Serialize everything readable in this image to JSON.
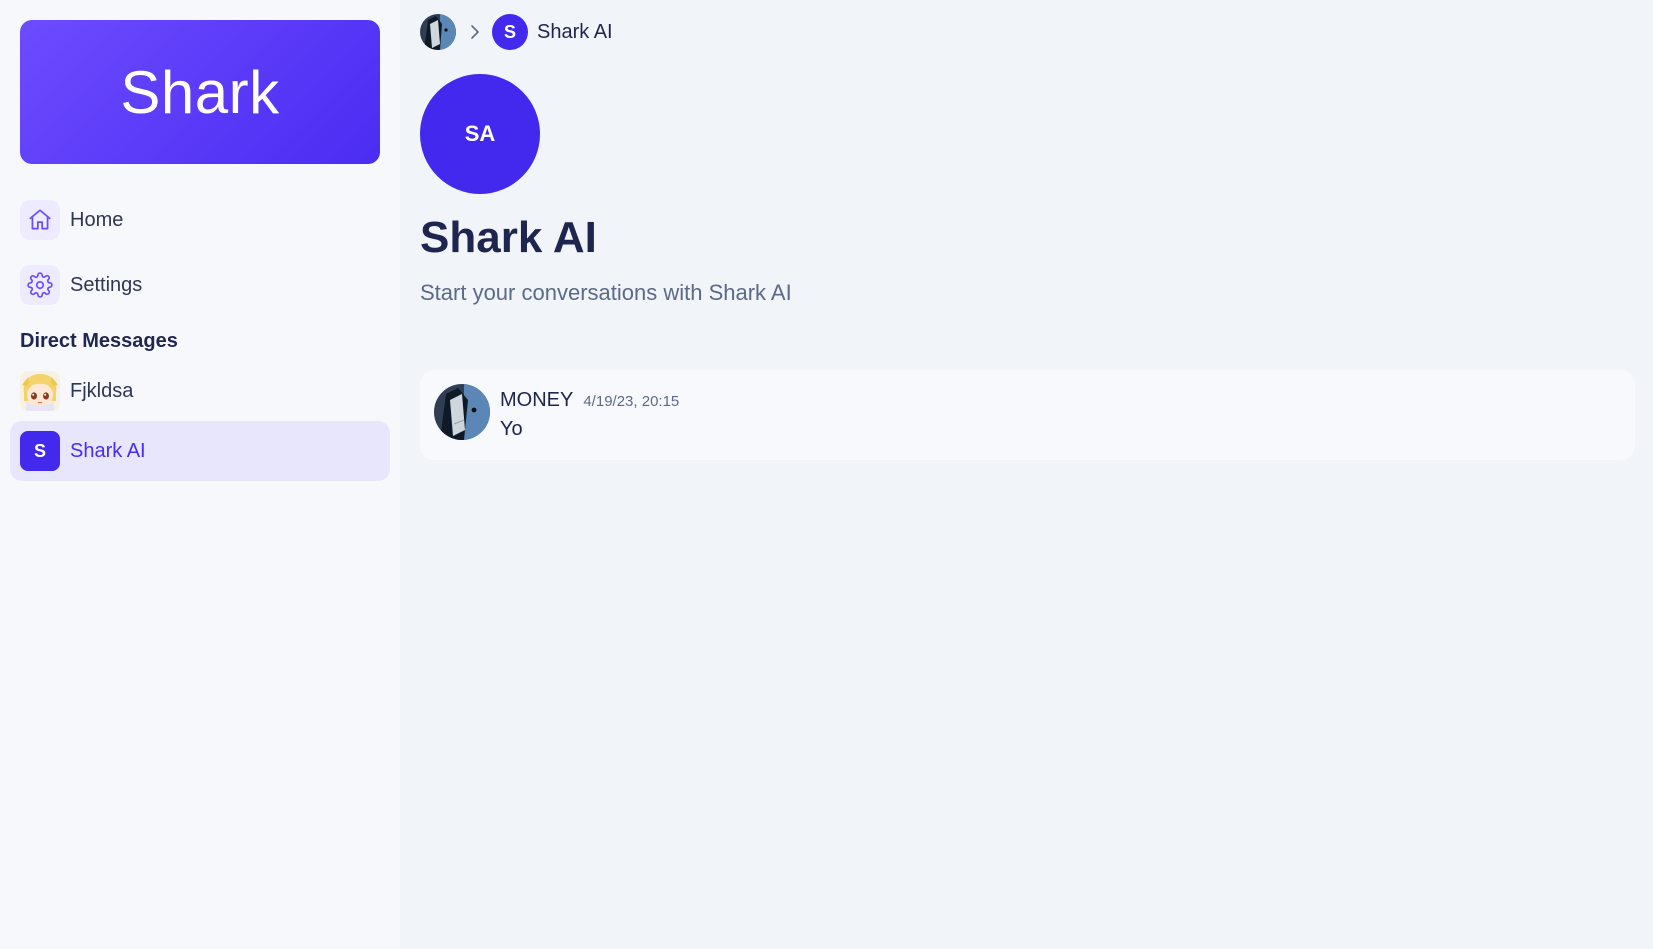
{
  "brand": {
    "name": "Shark"
  },
  "nav": [
    {
      "label": "Home",
      "icon": "home-icon"
    },
    {
      "label": "Settings",
      "icon": "gear-icon"
    }
  ],
  "direct_messages": {
    "title": "Direct Messages",
    "items": [
      {
        "label": "Fjkldsa",
        "avatar": "anime-avatar",
        "active": false
      },
      {
        "label": "Shark AI",
        "avatar_letter": "S",
        "active": true
      }
    ]
  },
  "breadcrumb": {
    "current_letter": "S",
    "current_label": "Shark AI"
  },
  "channel": {
    "avatar_initials": "SA",
    "title": "Shark AI",
    "subtitle": "Start your conversations with Shark AI"
  },
  "messages": [
    {
      "author": "MONEY",
      "time": "4/19/23, 20:15",
      "text": "Yo"
    }
  ],
  "colors": {
    "accent": "#4329ee",
    "brand_gradient_start": "#6d4bff",
    "brand_gradient_end": "#4b2cf2",
    "active_bg": "#e7e6fd",
    "text_dark": "#1e254f",
    "text_muted": "#5b6a88"
  }
}
